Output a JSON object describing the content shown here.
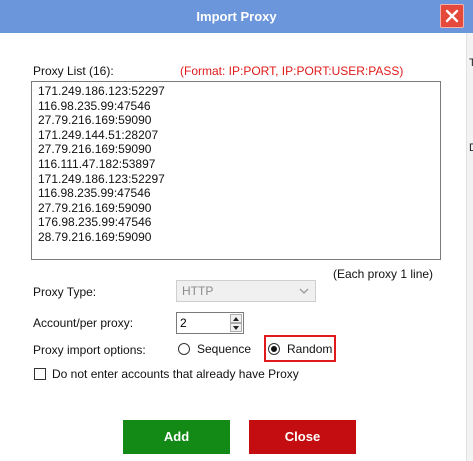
{
  "window": {
    "title": "Import Proxy"
  },
  "right_strip": {
    "glyph_top": "T",
    "glyph_mid": "D"
  },
  "proxy_list": {
    "label": "Proxy List (16):",
    "format_hint": "(Format: IP:PORT, IP:PORT:USER:PASS)",
    "lines": [
      "171.249.186.123:52297",
      "116.98.235.99:47546",
      "27.79.216.169:59090",
      "171.249.144.51:28207",
      "27.79.216.169:59090",
      "116.111.47.182:53897",
      "171.249.186.123:52297",
      "116.98.235.99:47546",
      "27.79.216.169:59090",
      "176.98.235.99:47546",
      "28.79.216.169:59090"
    ],
    "note": "(Each proxy 1 line)"
  },
  "proxy_type": {
    "label": "Proxy Type:",
    "value": "HTTP"
  },
  "account_per_proxy": {
    "label": "Account/per proxy:",
    "value": "2"
  },
  "import_options": {
    "label": "Proxy import options:",
    "sequence_label": "Sequence",
    "random_label": "Random",
    "selected": "Random"
  },
  "skip_existing": {
    "label": "Do not enter accounts that already have Proxy",
    "checked": false
  },
  "buttons": {
    "add": "Add",
    "close": "Close"
  },
  "colors": {
    "titlebar": "#6b96db",
    "close_x": "#e4493c",
    "format_hint": "#e01a1a",
    "add_button": "#128a15",
    "close_button": "#c40d10",
    "highlight": "#e01a1a"
  }
}
